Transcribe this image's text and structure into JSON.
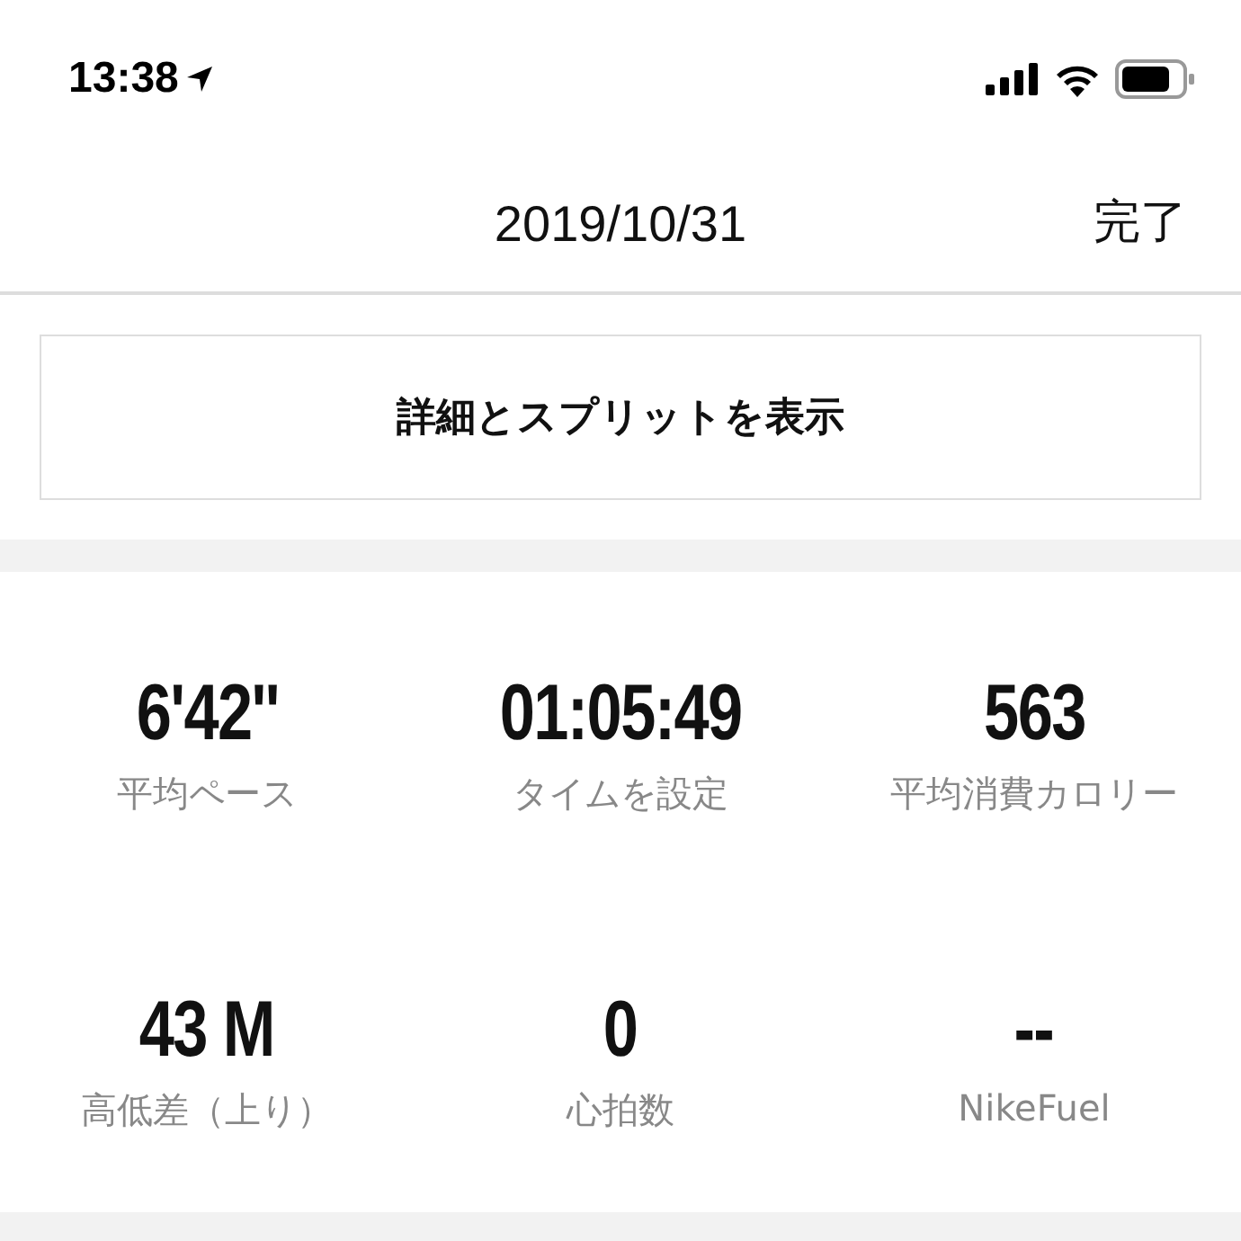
{
  "status_bar": {
    "time": "13:38"
  },
  "header": {
    "title": "2019/10/31",
    "done": "完了"
  },
  "details_button": "詳細とスプリットを表示",
  "stats": [
    {
      "value": "6'42''",
      "label": "平均ペース"
    },
    {
      "value": "01:05:49",
      "label": "タイムを設定"
    },
    {
      "value": "563",
      "label": "平均消費カロリー"
    },
    {
      "value": "43 M",
      "label": "高低差（上り）"
    },
    {
      "value": "0",
      "label": "心拍数"
    },
    {
      "value": "--",
      "label": "NikeFuel"
    }
  ]
}
